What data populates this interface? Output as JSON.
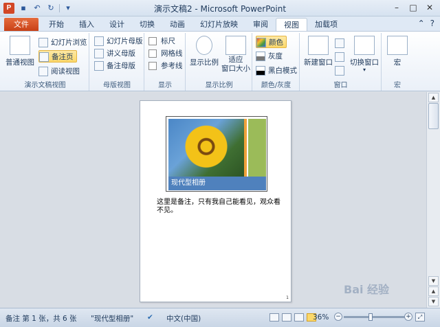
{
  "window": {
    "title": "演示文稿2 - Microsoft PowerPoint",
    "app_icon_letter": "P",
    "qat_icons": [
      "save-icon",
      "undo-icon",
      "redo-icon",
      "customize-qat-icon"
    ],
    "controls": {
      "minimize": "–",
      "restore": "□",
      "close": "✕"
    }
  },
  "tabs": [
    {
      "label": "文件"
    },
    {
      "label": "开始"
    },
    {
      "label": "插入"
    },
    {
      "label": "设计"
    },
    {
      "label": "切换"
    },
    {
      "label": "动画"
    },
    {
      "label": "幻灯片放映"
    },
    {
      "label": "审阅"
    },
    {
      "label": "视图"
    },
    {
      "label": "加载项"
    }
  ],
  "active_tab": "视图",
  "ribbon": {
    "groups": {
      "presentation_views": "演示文稿视图",
      "master_views": "母版视图",
      "show": "显示",
      "zoom": "显示比例",
      "color": "颜色/灰度",
      "window": "窗口",
      "macros": "宏"
    },
    "normal": "普通视图",
    "slide_sorter": "幻灯片浏览",
    "notes_page": "备注页",
    "reading_view": "阅读视图",
    "slide_master": "幻灯片母版",
    "handout_master": "讲义母版",
    "notes_master": "备注母版",
    "ruler": "标尺",
    "gridlines": "网格线",
    "guides": "参考线",
    "zoom_btn": "显示比例",
    "fit_line1": "适应",
    "fit_line2": "窗口大小",
    "color_btn": "颜色",
    "grayscale": "灰度",
    "black_white": "黑白模式",
    "new_window": "新建窗口",
    "switch_windows": "切换窗口",
    "macros_btn": "宏"
  },
  "document": {
    "slide_caption": "现代型相册",
    "notes_text": "这里是备注，只有我自己能看见，观众看不见。",
    "page_number": "1"
  },
  "status": {
    "slide_info": "备注 第 1 张，共 6 张",
    "theme": "\"现代型相册\"",
    "language": "中文(中国)",
    "zoom": "36%",
    "zoom_level": 0.36
  },
  "watermark": "Bai 经验"
}
